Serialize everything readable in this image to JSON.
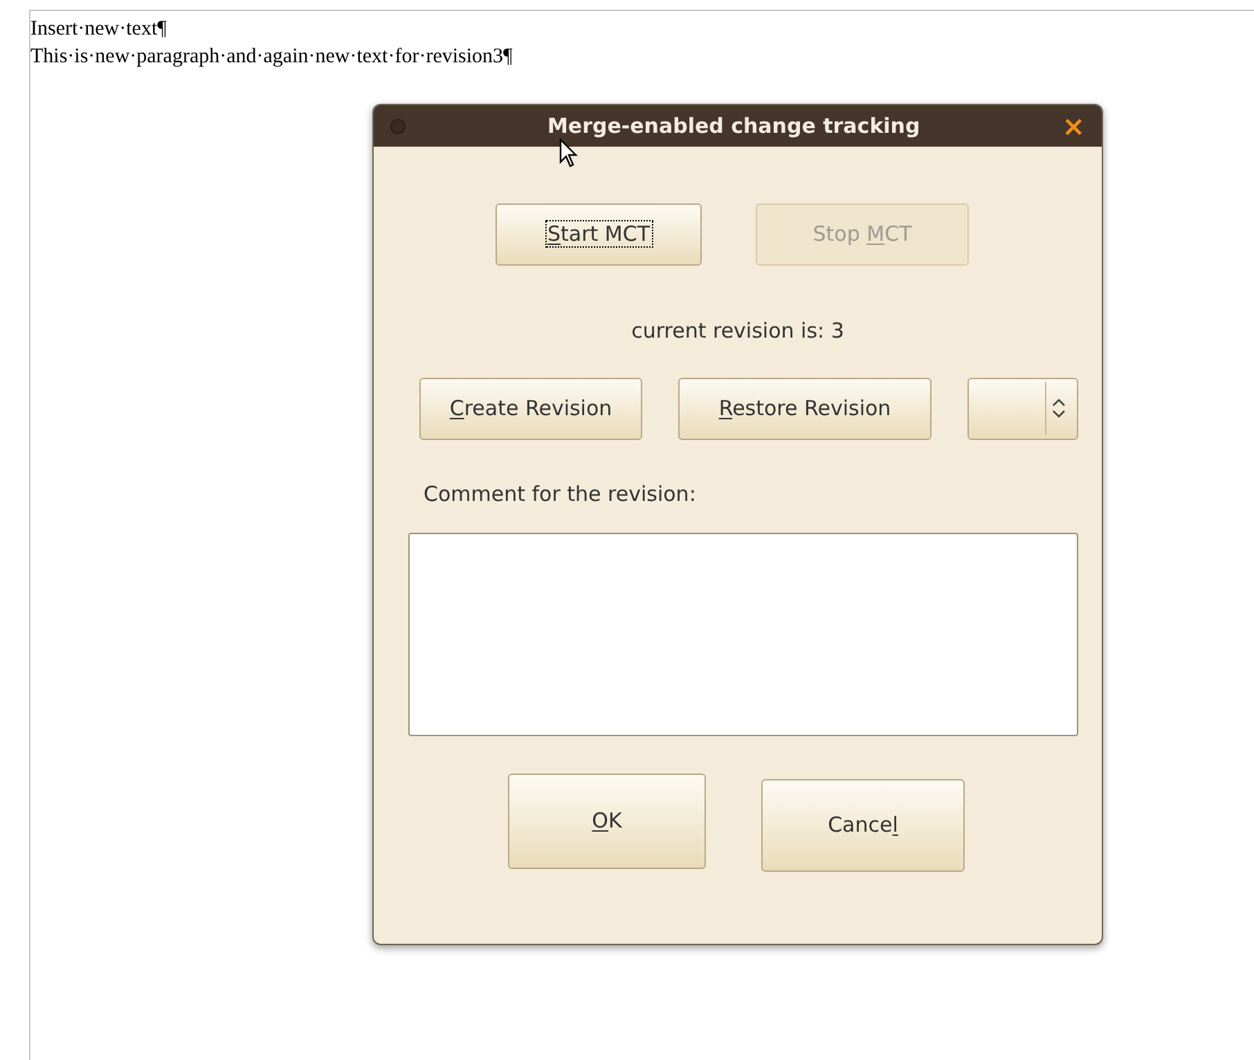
{
  "document": {
    "paragraphs": [
      "Insert·new·text¶",
      "This·is·new·paragraph·and·again·new·text·for·revision3¶"
    ]
  },
  "dialog": {
    "title": "Merge-enabled change tracking",
    "close_glyph": "×",
    "top_buttons": [
      {
        "key": "S",
        "after": "tart MCT",
        "disabled": false,
        "focused": true
      },
      {
        "before": "Stop ",
        "key": "M",
        "after": "CT",
        "disabled": true,
        "focused": false
      }
    ],
    "status": "current revision is: 3",
    "revision_buttons": [
      {
        "key": "C",
        "after": "reate Revision",
        "disabled": false,
        "focused": false
      },
      {
        "key": "R",
        "after": "estore Revision",
        "disabled": false,
        "focused": false
      }
    ],
    "comment_label": "Comment for the revision:",
    "bottom_buttons": [
      {
        "key": "O",
        "after": "K",
        "disabled": false,
        "focused": false
      },
      {
        "before": "Cance",
        "key": "l",
        "disabled": false,
        "focused": false
      }
    ]
  }
}
